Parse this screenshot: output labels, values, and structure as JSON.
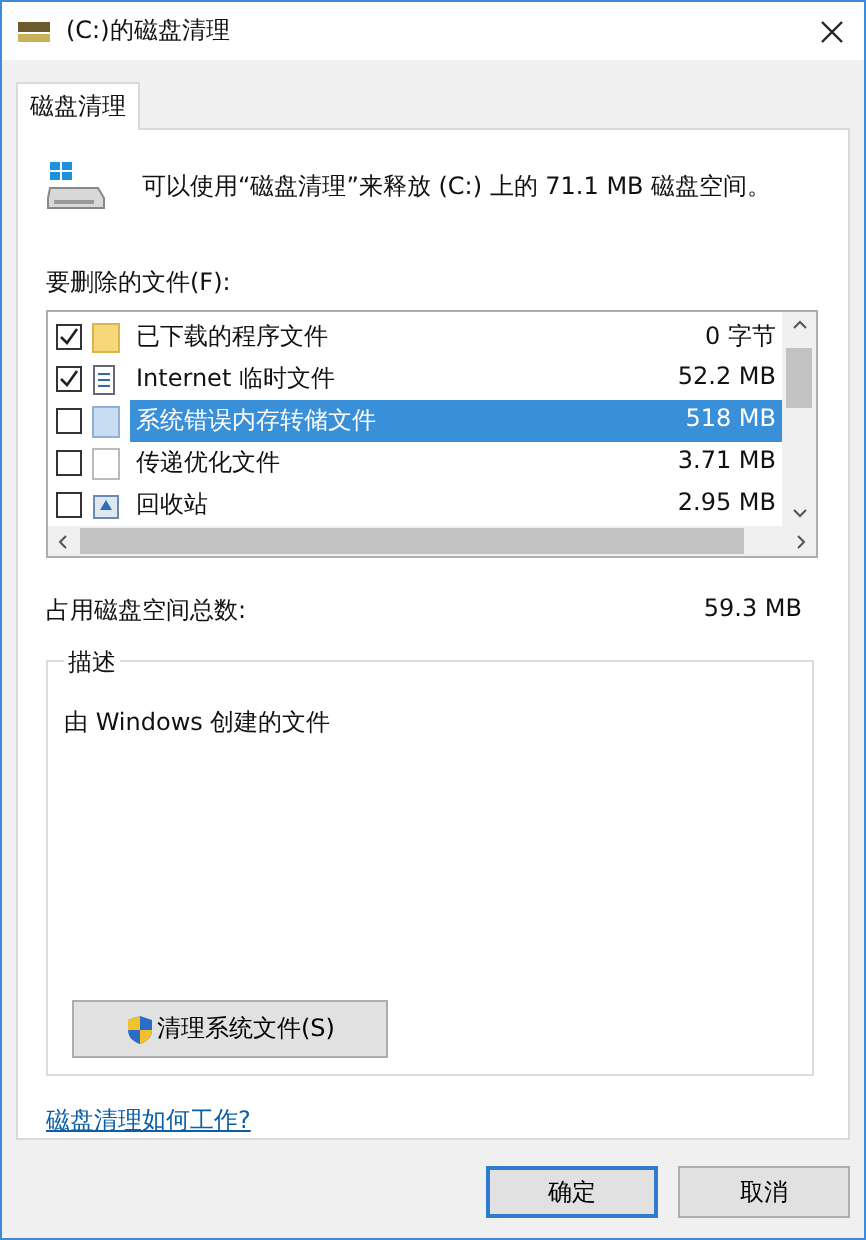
{
  "window": {
    "title": "(C:)的磁盘清理"
  },
  "tabs": [
    {
      "label": "磁盘清理",
      "selected": true
    }
  ],
  "header": {
    "text": "可以使用“磁盘清理”来释放 (C:) 上的 71.1 MB 磁盘空间。"
  },
  "files": {
    "label": "要删除的文件(F):",
    "rows": [
      {
        "checked": true,
        "kind": "folder",
        "name": "已下载的程序文件",
        "size": "0 字节",
        "selected": false
      },
      {
        "checked": true,
        "kind": "web",
        "name": "Internet 临时文件",
        "size": "52.2 MB",
        "selected": false
      },
      {
        "checked": false,
        "kind": "page",
        "name": "系统错误内存转储文件",
        "size": "518 MB",
        "selected": true
      },
      {
        "checked": false,
        "kind": "blank",
        "name": "传递优化文件",
        "size": "3.71 MB",
        "selected": false
      },
      {
        "checked": false,
        "kind": "recycle",
        "name": "回收站",
        "size": "2.95 MB",
        "selected": false
      }
    ]
  },
  "total": {
    "label": "占用磁盘空间总数:",
    "value": "59.3 MB"
  },
  "description": {
    "title": "描述",
    "text": "由 Windows 创建的文件"
  },
  "clean_button": {
    "label": "清理系统文件(S)"
  },
  "help_link": "磁盘清理如何工作?",
  "buttons": [
    {
      "label": "确定",
      "default": true
    },
    {
      "label": "取消",
      "default": false
    }
  ]
}
